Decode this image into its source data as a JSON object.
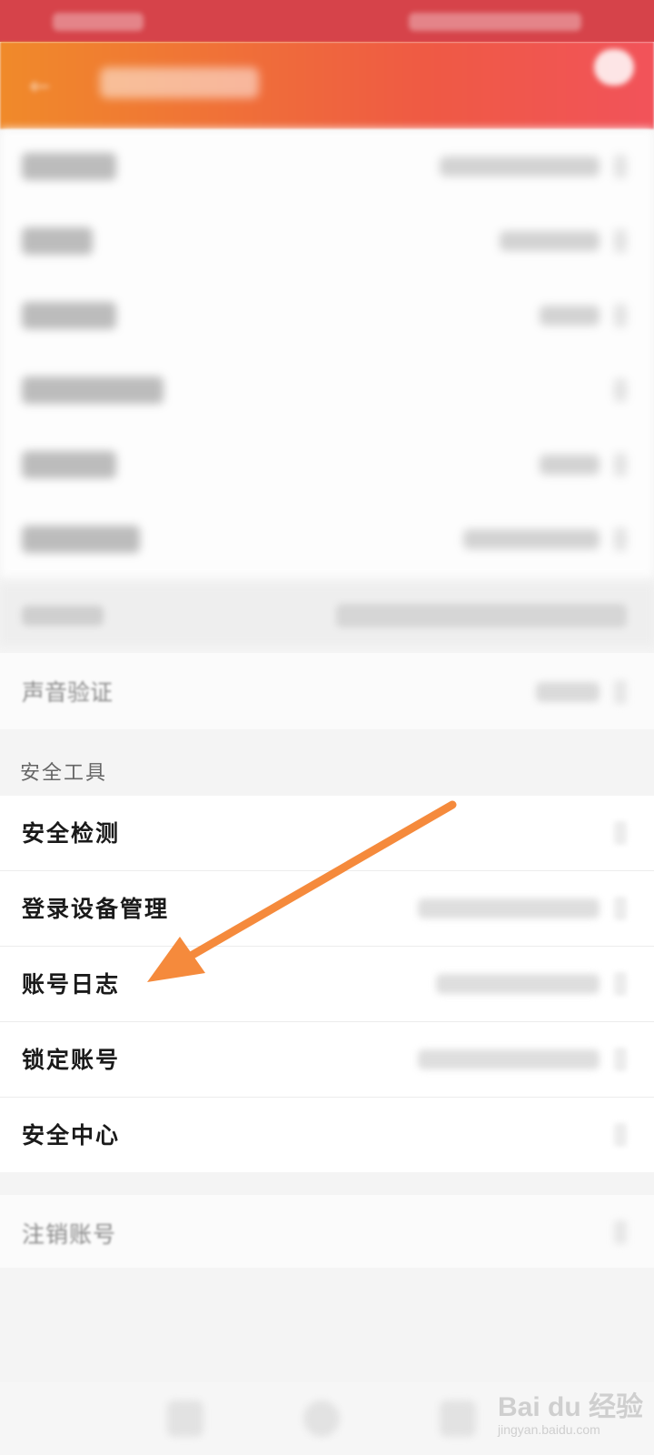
{
  "voice_verify": {
    "label": "声音验证"
  },
  "security_tools": {
    "section_title": "安全工具",
    "items": [
      {
        "label": "安全检测"
      },
      {
        "label": "登录设备管理"
      },
      {
        "label": "账号日志"
      },
      {
        "label": "锁定账号"
      },
      {
        "label": "安全中心"
      }
    ]
  },
  "logout": {
    "label": "注销账号"
  },
  "watermark": {
    "main": "Bai du 经验",
    "sub": "jingyan.baidu.com"
  },
  "colors": {
    "header_start": "#f08a2a",
    "header_end": "#f2535a",
    "annotation_arrow": "#f58a3c"
  },
  "icons": {
    "back": "back-arrow-icon",
    "service": "chat-bubble-icon",
    "chevron": "chevron-right-icon"
  }
}
